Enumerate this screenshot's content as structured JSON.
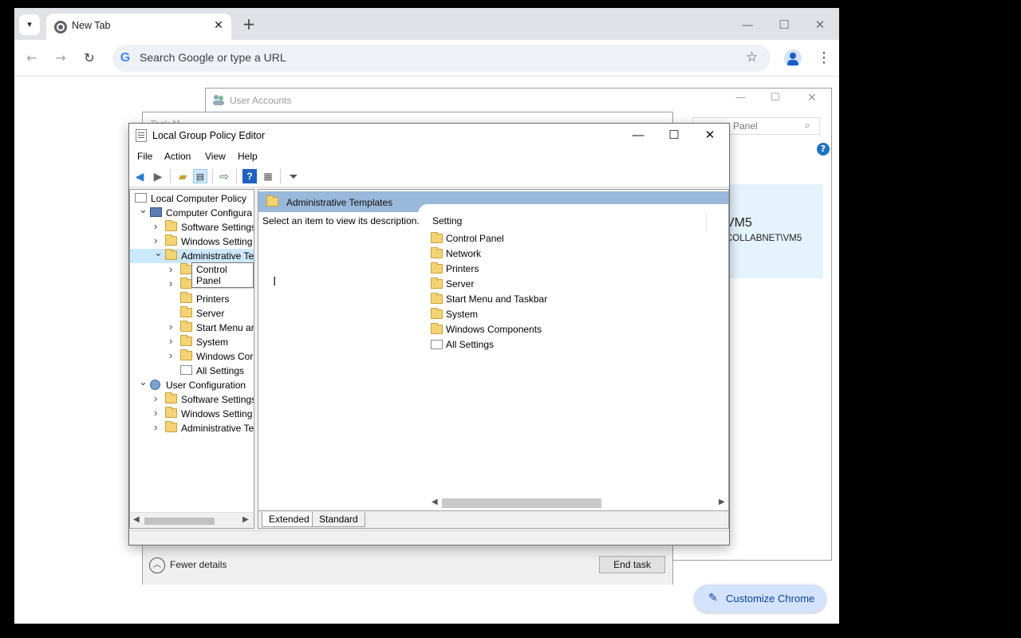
{
  "browser": {
    "tab_title": "New Tab",
    "tab_close": "✕",
    "new_tab": "+",
    "omnibox_placeholder": "Search Google or type a URL",
    "google_g": "G",
    "customize_label": "Customize Chrome",
    "colors": {
      "accent": "#d3e3fd",
      "tabstrip": "#dfe3e8"
    }
  },
  "user_accounts": {
    "title": "User Accounts",
    "search_text": "Panel",
    "account_name_partial": "VM5",
    "account_domain_partial": "COLLABNET\\VM5"
  },
  "task_manager": {
    "title_partial": "Task M",
    "fewer_details_label": "Fewer details",
    "end_task_label": "End task"
  },
  "gpe": {
    "title": "Local Group Policy Editor",
    "menus": [
      "File",
      "Action",
      "View",
      "Help"
    ],
    "tree": [
      {
        "label": "Local Computer Policy",
        "icon": "policy-icon",
        "level": 0,
        "twisty": ""
      },
      {
        "label": "Computer Configura",
        "icon": "computer-icon",
        "level": 1,
        "twisty": "expanded"
      },
      {
        "label": "Software Settings",
        "icon": "folder-icon",
        "level": 2,
        "twisty": "collapsed"
      },
      {
        "label": "Windows Setting",
        "icon": "folder-icon",
        "level": 2,
        "twisty": "collapsed"
      },
      {
        "label": "Administrative Te",
        "icon": "folder-open-icon",
        "level": 2,
        "twisty": "expanded",
        "selected": true
      },
      {
        "label": "",
        "icon": "folder-icon",
        "level": 3,
        "twisty": "collapsed"
      },
      {
        "label": "Network",
        "icon": "folder-icon",
        "level": 3,
        "twisty": "collapsed"
      },
      {
        "label": "Printers",
        "icon": "folder-icon",
        "level": 3,
        "twisty": ""
      },
      {
        "label": "Server",
        "icon": "folder-icon",
        "level": 3,
        "twisty": ""
      },
      {
        "label": "Start Menu ar",
        "icon": "folder-icon",
        "level": 3,
        "twisty": "collapsed"
      },
      {
        "label": "System",
        "icon": "folder-icon",
        "level": 3,
        "twisty": "collapsed"
      },
      {
        "label": "Windows Cor",
        "icon": "folder-icon",
        "level": 3,
        "twisty": "collapsed"
      },
      {
        "label": "All Settings",
        "icon": "settings-doc-icon",
        "level": 3,
        "twisty": ""
      },
      {
        "label": "User Configuration",
        "icon": "user-icon",
        "level": 1,
        "twisty": "expanded"
      },
      {
        "label": "Software Settings",
        "icon": "folder-icon",
        "level": 2,
        "twisty": "collapsed"
      },
      {
        "label": "Windows Setting",
        "icon": "folder-icon",
        "level": 2,
        "twisty": "collapsed"
      },
      {
        "label": "Administrative Te",
        "icon": "folder-icon",
        "level": 2,
        "twisty": "collapsed"
      }
    ],
    "tooltip": "Control Panel",
    "header_title": "Administrative Templates",
    "description": "Select an item to view its description.",
    "column_setting": "Setting",
    "items": [
      {
        "label": "Control Panel",
        "icon": "folder-icon"
      },
      {
        "label": "Network",
        "icon": "folder-icon"
      },
      {
        "label": "Printers",
        "icon": "folder-icon"
      },
      {
        "label": "Server",
        "icon": "folder-icon"
      },
      {
        "label": "Start Menu and Taskbar",
        "icon": "folder-icon"
      },
      {
        "label": "System",
        "icon": "folder-icon"
      },
      {
        "label": "Windows Components",
        "icon": "folder-icon"
      },
      {
        "label": "All Settings",
        "icon": "settings-doc-icon"
      }
    ],
    "tabs": [
      "Extended",
      "Standard"
    ]
  }
}
